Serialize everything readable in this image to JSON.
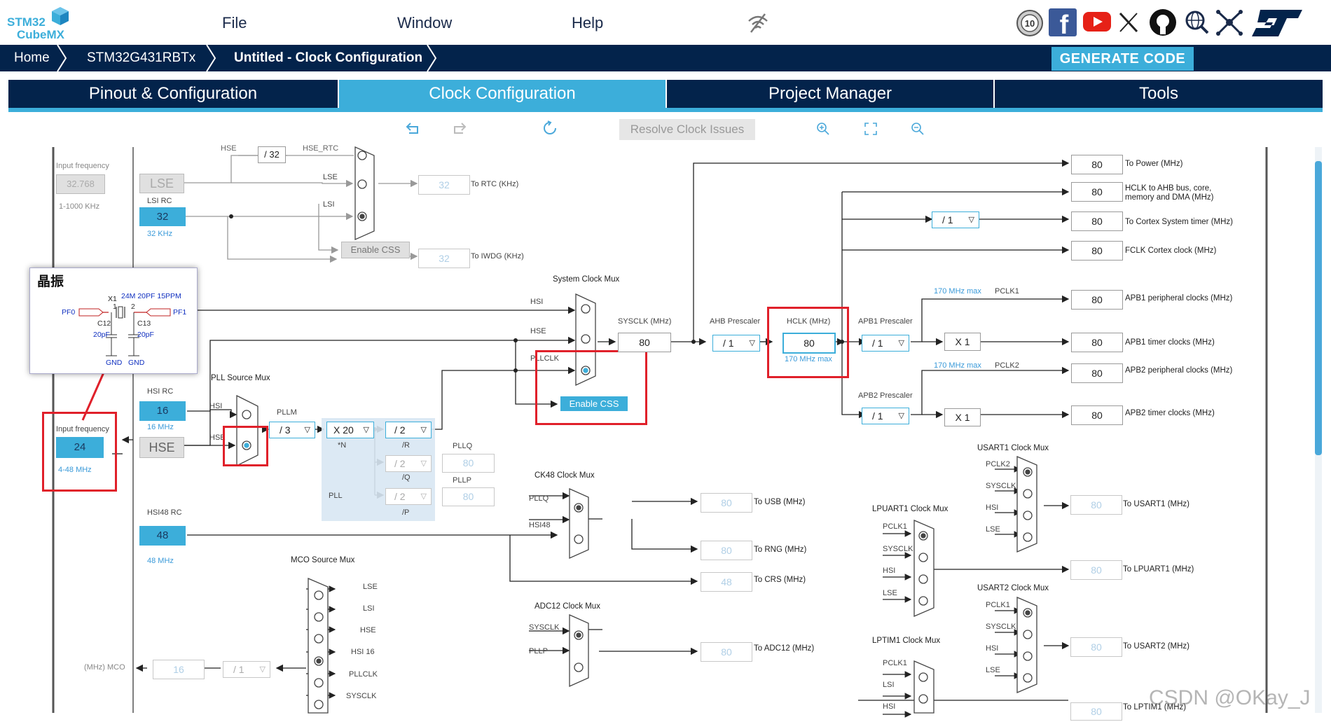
{
  "app": {
    "logo_top": "STM32",
    "logo_bottom": "CubeMX"
  },
  "menu": {
    "file": "File",
    "window": "Window",
    "help": "Help"
  },
  "header_icons": [
    "anniversary-badge-icon",
    "facebook-icon",
    "youtube-icon",
    "x-icon",
    "github-icon",
    "search-globe-icon",
    "network-icon",
    "st-logo-icon"
  ],
  "breadcrumb": {
    "home": "Home",
    "device": "STM32G431RBTx",
    "page": "Untitled - Clock Configuration"
  },
  "generate_label": "GENERATE CODE",
  "tabs": [
    {
      "label": "Pinout & Configuration"
    },
    {
      "label": "Clock Configuration"
    },
    {
      "label": "Project Manager"
    },
    {
      "label": "Tools"
    }
  ],
  "toolbar": {
    "resolve": "Resolve Clock Issues"
  },
  "diagram": {
    "input_freq_label": "Input frequency",
    "lse_input": "32.768",
    "lse_range": "1-1000 KHz",
    "lse": "LSE",
    "lsi_rc": "LSI RC",
    "lsi_val": "32",
    "lsi_unit": "32 KHz",
    "rtc_div": "/ 32",
    "rtc_hse": "HSE",
    "rtc_hse_rtc": "HSE_RTC",
    "rtc_lse": "LSE",
    "rtc_lsi": "LSI",
    "rtc_val": "32",
    "rtc_label": "To RTC (KHz)",
    "enable_css_dim": "Enable CSS",
    "iwdg_val": "32",
    "iwdg_label": "To IWDG (KHz)",
    "crystal_title": "晶振",
    "crystal_x1": "X1",
    "crystal_part": "24M 20PF 15PPM",
    "crystal_pf0": "PF0",
    "crystal_pf1": "PF1",
    "crystal_pin1": "1",
    "crystal_pin2": "2",
    "crystal_c12": "C12",
    "crystal_c13": "C13",
    "crystal_c12v": "20pF",
    "crystal_c13v": "20pF",
    "crystal_gnd1": "GND",
    "crystal_gnd2": "GND",
    "hsi_rc": "HSI RC",
    "hsi_val": "16",
    "hsi_unit": "16 MHz",
    "hse_input": "24",
    "hse_range": "4-48 MHz",
    "hse": "HSE",
    "pll_src_mux": "PLL Source Mux",
    "pll_hsi": "HSI",
    "pll_hse": "HSE",
    "pllm": "PLLM",
    "pllm_val": "/ 3",
    "pll_n_val": "X 20",
    "pll_n": "*N",
    "pll_r_val": "/ 2",
    "pll_r": "/R",
    "pll_q_val": "/ 2",
    "pll_q": "/Q",
    "pll_p_val": "/ 2",
    "pll_p": "/P",
    "pll": "PLL",
    "pllq": "PLLQ",
    "pllq_val": "80",
    "pllp": "PLLP",
    "pllp_val": "80",
    "hsi48_rc": "HSI48 RC",
    "hsi48_val": "48",
    "hsi48_unit": "48 MHz",
    "sys_mux": "System Clock Mux",
    "sys_hsi": "HSI",
    "sys_hse": "HSE",
    "sys_pllclk": "PLLCLK",
    "enable_css": "Enable CSS",
    "sysclk_label": "SYSCLK (MHz)",
    "sysclk_val": "80",
    "ahb_prescaler": "AHB Prescaler",
    "ahb_val": "/ 1",
    "hclk_label": "HCLK (MHz)",
    "hclk_val": "80",
    "hclk_max": "170 MHz max",
    "apb1_prescaler": "APB1 Prescaler",
    "apb1_val": "/ 1",
    "apb2_prescaler": "APB2 Prescaler",
    "apb2_val": "/ 1",
    "x1_a": "X 1",
    "x1_b": "X 1",
    "cortex_div": "/ 1",
    "max1": "170 MHz max",
    "pclk1": "PCLK1",
    "max2": "170 MHz max",
    "pclk2": "PCLK2",
    "outputs": [
      {
        "val": "80",
        "label": "To Power (MHz)"
      },
      {
        "val": "80",
        "label": "HCLK to AHB bus, core, memory and DMA (MHz)"
      },
      {
        "val": "80",
        "label": "To Cortex System timer (MHz)"
      },
      {
        "val": "80",
        "label": "FCLK Cortex clock (MHz)"
      },
      {
        "val": "80",
        "label": "APB1 peripheral clocks (MHz)"
      },
      {
        "val": "80",
        "label": "APB1 timer clocks (MHz)"
      },
      {
        "val": "80",
        "label": "APB2 peripheral clocks (MHz)"
      },
      {
        "val": "80",
        "label": "APB2 timer clocks (MHz)"
      }
    ],
    "ck48_mux": "CK48 Clock Mux",
    "ck48_pllq": "PLLQ",
    "ck48_hsi48": "HSI48",
    "usb_val": "80",
    "usb_label": "To USB (MHz)",
    "rng_val": "80",
    "rng_label": "To RNG (MHz)",
    "crs_val": "48",
    "crs_label": "To CRS (MHz)",
    "adc_mux": "ADC12 Clock Mux",
    "adc_sysclk": "SYSCLK",
    "adc_pllp": "PLLP",
    "adc_val": "80",
    "adc_label": "To ADC12 (MHz)",
    "mco_mux": "MCO Source Mux",
    "mco_inputs": [
      "LSE",
      "LSI",
      "HSE",
      "HSI 16",
      "PLLCLK",
      "SYSCLK"
    ],
    "mco_label": "(MHz) MCO",
    "mco_val": "16",
    "mco_div": "/ 1",
    "lpuart1_mux": "LPUART1 Clock Mux",
    "lpuart1_inputs": [
      "PCLK1",
      "SYSCLK",
      "HSI",
      "LSE"
    ],
    "lpuart1_val": "80",
    "lpuart1_label": "To LPUART1 (MHz)",
    "usart1_mux": "USART1 Clock Mux",
    "usart1_inputs": [
      "PCLK2",
      "SYSCLK",
      "HSI",
      "LSE"
    ],
    "usart1_val": "80",
    "usart1_label": "To USART1 (MHz)",
    "usart2_mux": "USART2 Clock Mux",
    "usart2_inputs": [
      "PCLK1",
      "SYSCLK",
      "HSI",
      "LSE"
    ],
    "usart2_val": "80",
    "usart2_label": "To USART2 (MHz)",
    "lptim1_mux": "LPTIM1 Clock Mux",
    "lptim1_inputs": [
      "PCLK1",
      "LSI",
      "HSI"
    ],
    "lptim1_val": "80",
    "lptim1_label": "To LPTIM1 (MHz)"
  },
  "watermark": "CSDN @OKay_J",
  "colors": {
    "navy": "#03234b",
    "accent": "#3caeda",
    "highlight": "#e0202a"
  }
}
